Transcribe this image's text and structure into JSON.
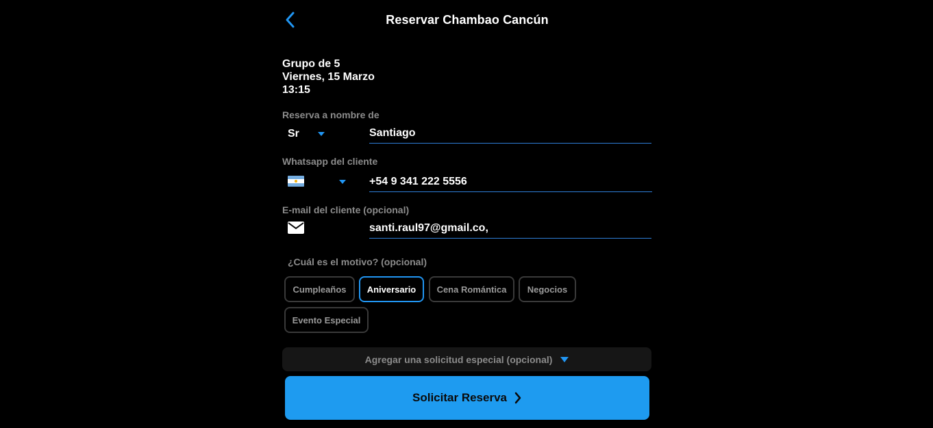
{
  "header": {
    "title": "Reservar Chambao Cancún",
    "back_icon": "chevron-left-icon"
  },
  "summary": {
    "group": "Grupo de 5",
    "date": "Viernes, 15 Marzo",
    "time": "13:15"
  },
  "name_field": {
    "label": "Reserva a nombre de",
    "title_value": "Sr",
    "value": "Santiago"
  },
  "whatsapp_field": {
    "label": "Whatsapp del cliente",
    "country_flag": "argentina-flag-icon",
    "value": "+54 9 341 222 5556"
  },
  "email_field": {
    "label": "E-mail del cliente (opcional)",
    "icon": "envelope-icon",
    "value": "santi.raul97@gmail.co,"
  },
  "motivo": {
    "label": "¿Cuál es el motivo? (opcional)",
    "options": [
      "Cumpleaños",
      "Aniversario",
      "Cena Romántica",
      "Negocios",
      "Evento Especial"
    ],
    "selected": "Aniversario"
  },
  "special_request": {
    "label": "Agregar una solicitud especial (opcional)"
  },
  "submit": {
    "label": "Solicitar Reserva"
  },
  "colors": {
    "accent": "#1e9bf0",
    "background": "#000000",
    "muted_text": "#8c8c8c"
  }
}
